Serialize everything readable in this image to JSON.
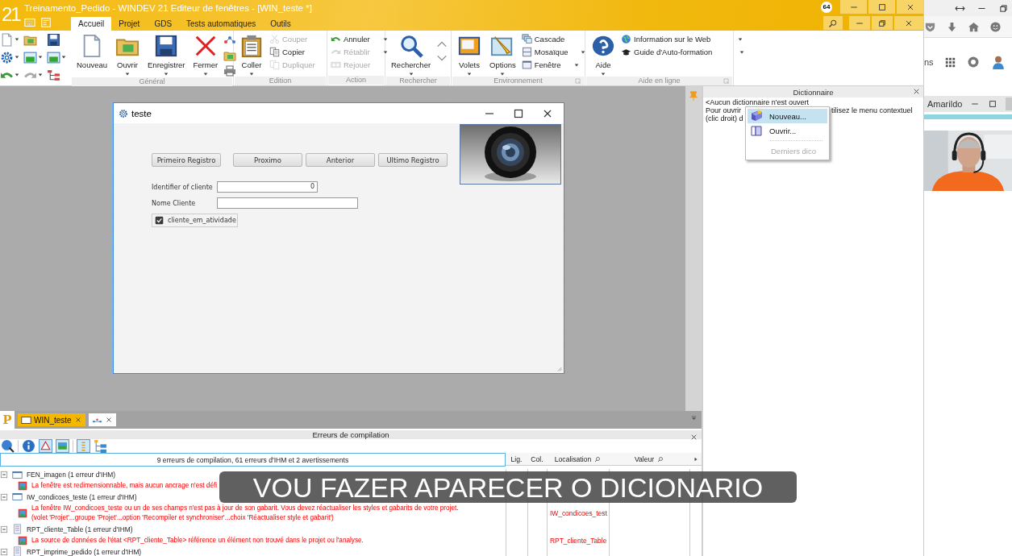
{
  "window": {
    "logo": "21",
    "title": "Treinamento_Pedido - WINDEV 21  Editeur de fenêtres - [WIN_teste *]",
    "badge": "64"
  },
  "menu_tabs": [
    {
      "label": "Accueil",
      "selected": true
    },
    {
      "label": "Projet",
      "selected": false
    },
    {
      "label": "GDS",
      "selected": false
    },
    {
      "label": "Tests automatiques",
      "selected": false
    },
    {
      "label": "Outils",
      "selected": false
    }
  ],
  "ribbon": {
    "groups": [
      {
        "title": "Général",
        "large": [
          "Nouveau",
          "Ouvrir",
          "Enregistrer",
          "Fermer"
        ]
      },
      {
        "title": "Edition",
        "large": [
          "Coller"
        ],
        "small": [
          {
            "label": "Couper",
            "disabled": true
          },
          {
            "label": "Copier",
            "disabled": false
          },
          {
            "label": "Dupliquer",
            "disabled": true
          }
        ]
      },
      {
        "title": "Action",
        "small": [
          {
            "label": "Annuler",
            "disabled": false
          },
          {
            "label": "Rétablir",
            "disabled": true
          },
          {
            "label": "Rejouer",
            "disabled": true
          }
        ]
      },
      {
        "title": "Rechercher",
        "large": [
          "Rechercher"
        ]
      },
      {
        "title": "Environnement",
        "large": [
          "Volets",
          "Options"
        ],
        "small": [
          {
            "label": "Cascade",
            "disabled": false
          },
          {
            "label": "Mosaïque",
            "disabled": false
          },
          {
            "label": "Fenêtre",
            "disabled": false
          }
        ]
      },
      {
        "title": "Aide en ligne",
        "large": [
          "Aide"
        ],
        "small": [
          {
            "label": "Information sur le Web",
            "disabled": false
          },
          {
            "label": "Guide d'Auto-formation",
            "disabled": false
          }
        ]
      }
    ]
  },
  "designer": {
    "title": "teste",
    "buttons": [
      "Primeiro Registro",
      "Proximo",
      "Anterior",
      "Ultimo Registro"
    ],
    "fields": [
      {
        "label": "Identifier of cliente",
        "value": "0"
      },
      {
        "label": "Nome Cliente"
      }
    ],
    "checkbox": {
      "label": "cliente_em_atividade",
      "checked": true
    }
  },
  "dictionary": {
    "title": "Dictionnaire",
    "lines": [
      "<Aucun dictionnaire n'est ouvert",
      "Pour ouvrir",
      "tilisez le menu contextuel",
      "(clic droit) d"
    ],
    "context_menu": [
      {
        "label": "Nouveau...",
        "selected": true,
        "disabled": false
      },
      {
        "label": "Ouvrir...",
        "selected": false,
        "disabled": false
      },
      {
        "label": "Derniers dico",
        "selected": false,
        "disabled": true
      }
    ]
  },
  "document_tabs": {
    "project_logo": "P",
    "tabs": [
      {
        "label": "WIN_teste",
        "selected": true
      },
      {
        "selected": false
      }
    ]
  },
  "errors": {
    "title": "Erreurs de compilation",
    "summary": "9 erreurs de compilation, 61 erreurs d'IHM et 2 avertissements",
    "columns": [
      "Lig.",
      "Col.",
      "Localisation",
      "Valeur"
    ],
    "groups": [
      {
        "name": "FEN_imagen (1 erreur d'IHM)",
        "expanded": true,
        "children": [
          {
            "text": "La fenêtre est redimensionnable, mais aucun ancrage n'est défi"
          }
        ]
      },
      {
        "name": "IW_condicoes_teste (1 erreur d'IHM)",
        "expanded": true,
        "children": [
          {
            "text": "La fenêtre IW_condicoes_teste ou un de ses champs n'est pas à jour de son gabarit. Vous devez réactualiser les styles et gabarits de votre projet.\n(volet 'Projet'...groupe 'Projet'...option 'Recompiler et synchroniser'...choix 'Réactualiser style et gabarit')",
            "location": "IW_condicoes_test"
          }
        ]
      },
      {
        "name": "RPT_cliente_Table (1 erreur d'IHM)",
        "expanded": true,
        "children": [
          {
            "text": "La source de données de l'état <RPT_cliente_Table> référence un élément non trouvé dans le projet ou l'analyse.",
            "location": "RPT_cliente_Table"
          }
        ]
      },
      {
        "name": "RPT_imprime_pedido (1 erreur d'IHM)",
        "expanded": true
      }
    ]
  },
  "side_app": {
    "text": "ns",
    "contact": "Amarildo"
  },
  "caption": "VOU FAZER APARECER O DICIONARIO"
}
